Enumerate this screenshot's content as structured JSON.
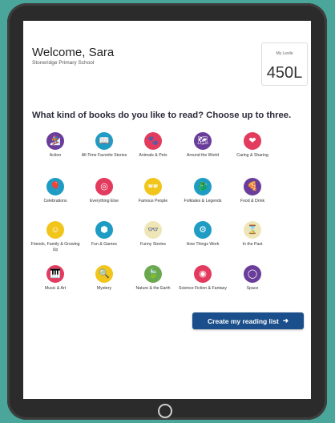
{
  "header": {
    "welcome": "Welcome, Sara",
    "school": "Stoneridge Primary School"
  },
  "lexile": {
    "label": "My Lexile",
    "value": "450L"
  },
  "question": "What kind of books do you like to read? Choose up to three.",
  "genres": [
    {
      "label": "Action",
      "icon": "snowboarder-icon",
      "color": "#6a3d9a"
    },
    {
      "label": "All-Time Favorite Stories",
      "icon": "book-icon",
      "color": "#1e9cc4"
    },
    {
      "label": "Animals & Pets",
      "icon": "paw-icon",
      "color": "#e23b5e"
    },
    {
      "label": "Around the World",
      "icon": "map-icon",
      "color": "#6a3d9a"
    },
    {
      "label": "Caring & Sharing",
      "icon": "heart-icon",
      "color": "#e23b5e"
    },
    {
      "label": "Celebrations",
      "icon": "balloon-icon",
      "color": "#1e9cc4"
    },
    {
      "label": "Everything Else",
      "icon": "target-icon",
      "color": "#e23b5e"
    },
    {
      "label": "Famous People",
      "icon": "sunglasses-icon",
      "color": "#f2c51b"
    },
    {
      "label": "Folktales & Legends",
      "icon": "dragon-icon",
      "color": "#1e9cc4"
    },
    {
      "label": "Food & Drink",
      "icon": "pizza-icon",
      "color": "#6a3d9a"
    },
    {
      "label": "Friends, Family & Growing Up",
      "icon": "person-icon",
      "color": "#f2c51b"
    },
    {
      "label": "Fun & Games",
      "icon": "cube-icon",
      "color": "#1e9cc4"
    },
    {
      "label": "Funny Stories",
      "icon": "glasses-mustache-icon",
      "color": "#efe6b8"
    },
    {
      "label": "How Things Work",
      "icon": "gears-icon",
      "color": "#1e9cc4"
    },
    {
      "label": "In the Past",
      "icon": "hourglass-icon",
      "color": "#efe6b8"
    },
    {
      "label": "Music & Art",
      "icon": "piano-icon",
      "color": "#e23b5e"
    },
    {
      "label": "Mystery",
      "icon": "magnifier-icon",
      "color": "#f2c51b"
    },
    {
      "label": "Nature & the Earth",
      "icon": "leaf-icon",
      "color": "#6aa84f"
    },
    {
      "label": "Science Fiction & Fantasy",
      "icon": "robot-icon",
      "color": "#e23b5e"
    },
    {
      "label": "Space",
      "icon": "planet-icon",
      "color": "#6a3d9a"
    }
  ],
  "cta": {
    "label": "Create my reading list",
    "arrow": "➜"
  }
}
